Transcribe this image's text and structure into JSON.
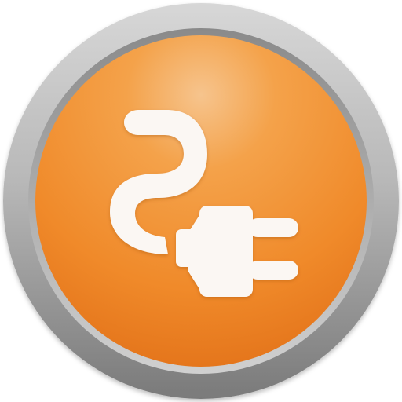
{
  "icon": {
    "name": "power-plug-icon",
    "colors": {
      "ring_light": "#c9c9c9",
      "ring_dark": "#7e7e7e",
      "disc_highlight": "#f6c48d",
      "disc_mid": "#f39a3a",
      "disc_edge": "#ea7a1f",
      "glyph": "#fbf7f3"
    }
  }
}
